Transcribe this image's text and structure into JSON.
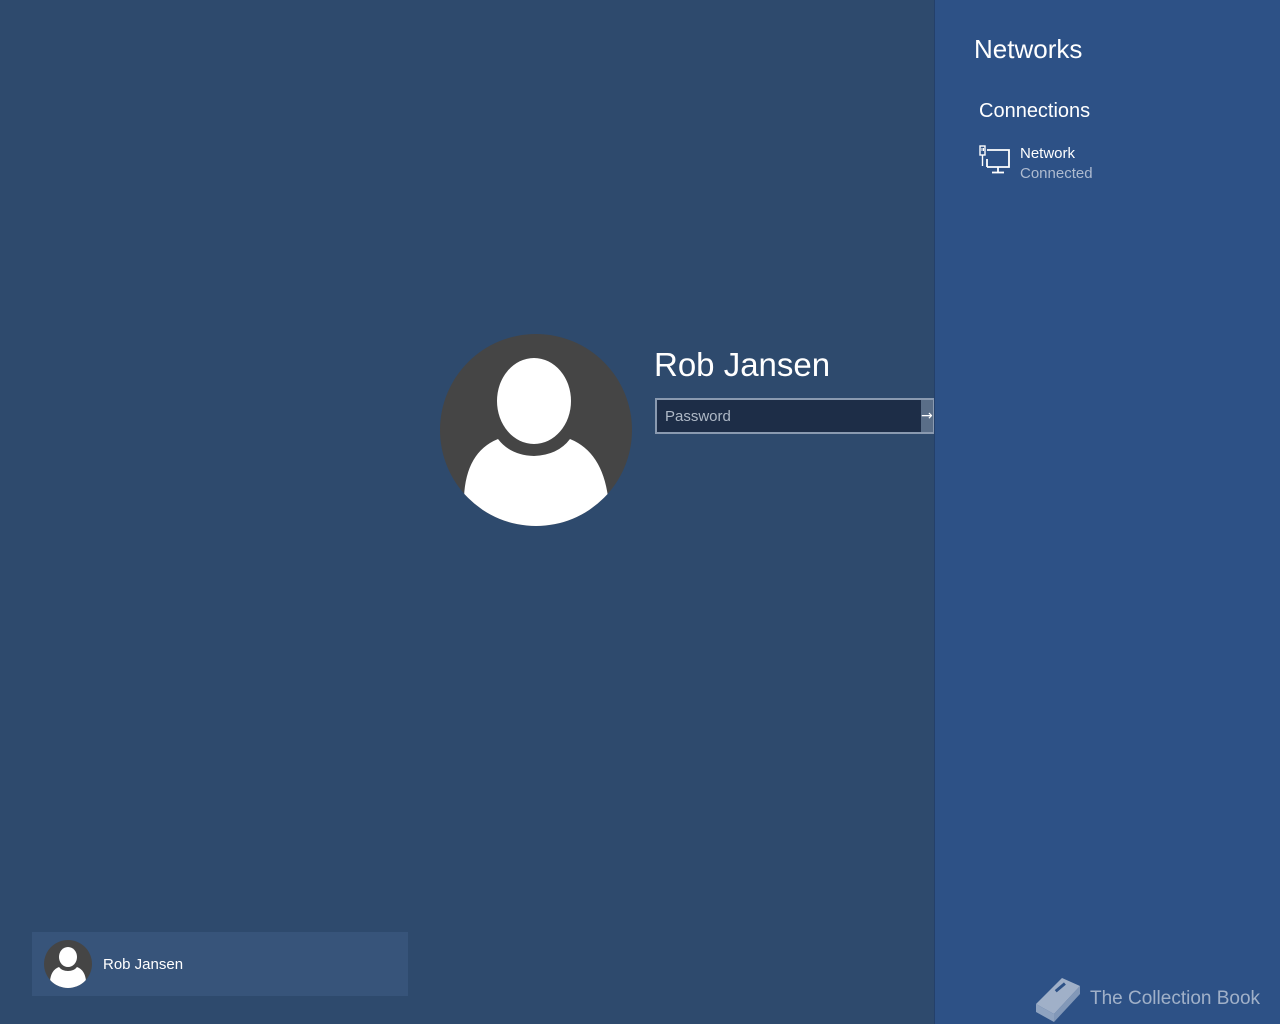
{
  "login": {
    "username": "Rob Jansen",
    "password_placeholder": "Password",
    "submit_glyph": "→"
  },
  "user_switcher": {
    "users": [
      {
        "name": "Rob Jansen"
      }
    ]
  },
  "networks_panel": {
    "title": "Networks",
    "section_title": "Connections",
    "connections": [
      {
        "name": "Network",
        "status": "Connected",
        "icon": "wired-network-icon"
      }
    ]
  },
  "watermark": {
    "text": "The Collection Book",
    "icon": "book-icon"
  },
  "colors": {
    "background": "#2e4a6d",
    "panel": "#2d5186",
    "avatar": "#454545",
    "user_tile": "#37547a",
    "password_field": "#1d2d47"
  }
}
